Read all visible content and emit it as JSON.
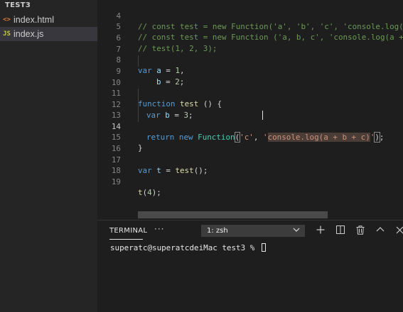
{
  "explorer": {
    "project": "TEST3",
    "files": [
      {
        "icon": "<>",
        "name": "index.html"
      },
      {
        "icon": "JS",
        "name": "index.js"
      }
    ]
  },
  "editor": {
    "line_numbers": [
      "4",
      "5",
      "6",
      "7",
      "8",
      "9",
      "10",
      "11",
      "12",
      "13",
      "14",
      "15",
      "16",
      "17",
      "18",
      "19"
    ],
    "active_line": "14",
    "lines": {
      "l4": [
        "// const test = new Function('a', 'b', 'c', 'console.log(a + b + c)');"
      ],
      "l5": [
        "// const test = new Function ('a, b, c', 'console.log(a + b + c)');"
      ],
      "l6": [
        "// test(1, 2, 3);"
      ],
      "l8": [
        "var",
        " ",
        "a",
        " = ",
        "1",
        ","
      ],
      "l9": [
        "b",
        " = ",
        "2",
        ";"
      ],
      "l11": [
        "function",
        " ",
        "test",
        " () {"
      ],
      "l12": [
        "var",
        " ",
        "b",
        " = ",
        "3",
        ";"
      ],
      "l14": [
        "return",
        " ",
        "new",
        " ",
        "Function",
        "(",
        "'c'",
        ", ",
        "'",
        "console.log(a + b + c)",
        "'",
        ")",
        ";"
      ],
      "l15": [
        "}"
      ],
      "l17": [
        "var",
        " ",
        "t",
        " = ",
        "test",
        "();"
      ],
      "l19": [
        "t",
        "(",
        "4",
        ");"
      ]
    }
  },
  "panel": {
    "tab": "TERMINAL",
    "more": "···",
    "terminal_select": "1: zsh",
    "prompt": "superatc@superatcdeiMac test3 % "
  },
  "icons": {
    "chevron": "chevron-down-icon",
    "add": "plus-icon",
    "split": "split-terminal-icon",
    "trash": "trash-icon",
    "maximize": "chevron-up-icon",
    "close": "close-icon"
  }
}
